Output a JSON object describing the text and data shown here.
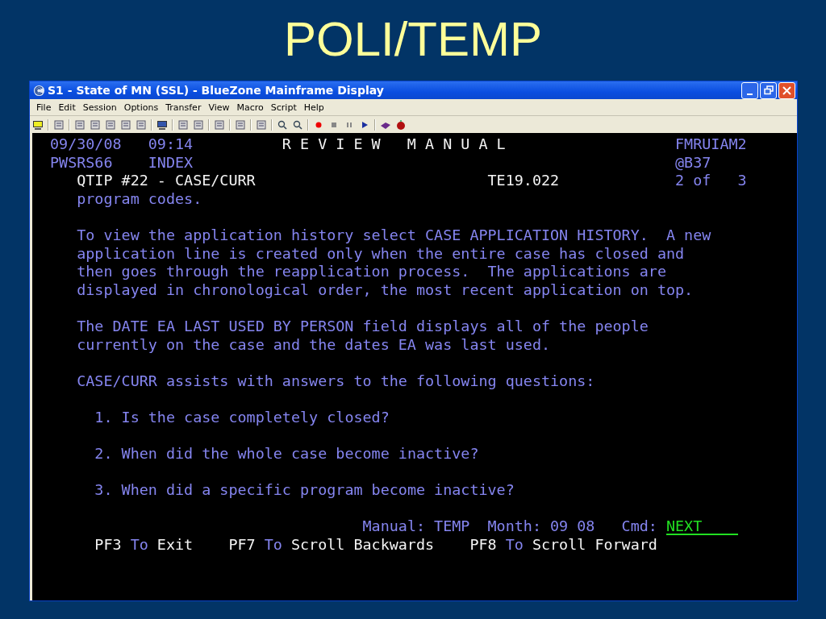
{
  "slide_title": "POLI/TEMP",
  "window": {
    "title": "S1 - State of MN (SSL) - BlueZone Mainframe Display",
    "menu": [
      {
        "label": "File"
      },
      {
        "label": "Edit"
      },
      {
        "label": "Session"
      },
      {
        "label": "Options"
      },
      {
        "label": "Transfer"
      },
      {
        "label": "View"
      },
      {
        "label": "Macro"
      },
      {
        "label": "Script"
      },
      {
        "label": "Help"
      }
    ]
  },
  "terminal": {
    "header": {
      "date": "09/30/08",
      "time": "09:14",
      "screen_title": "R E V I E W   M A N U A L",
      "screen_id": "FMRUIAM2",
      "user": "PWSRS66",
      "mode": "INDEX",
      "location": "@B37",
      "topic": "QTIP #22 - CASE/CURR",
      "reference": "TE19.022",
      "page": "2 of",
      "page_total": "3"
    },
    "body": [
      {
        "kind": "text",
        "lines": [
          "program codes."
        ]
      },
      {
        "kind": "text",
        "lines": [
          "To view the application history select CASE APPLICATION HISTORY.  A new",
          "application line is created only when the entire case has closed and",
          "then goes through the reapplication process.  The applications are",
          "displayed in chronological order, the most recent application on top."
        ]
      },
      {
        "kind": "text",
        "lines": [
          "The DATE EA LAST USED BY PERSON field displays all of the people",
          "currently on the case and the dates EA was last used."
        ]
      },
      {
        "kind": "text",
        "lines": [
          "CASE/CURR assists with answers to the following questions:"
        ]
      },
      {
        "kind": "item",
        "lines": [
          "1. Is the case completely closed?"
        ]
      },
      {
        "kind": "item",
        "lines": [
          "2. When did the whole case become inactive?"
        ]
      },
      {
        "kind": "item",
        "lines": [
          "3. When did a specific program become inactive?"
        ]
      }
    ],
    "footer": {
      "manual_label": "Manual:",
      "manual": "TEMP",
      "month_label": "Month:",
      "month": "09 08",
      "cmd_label": "Cmd:",
      "cmd": "NEXT",
      "keys": [
        {
          "key": "PF3",
          "to": "To",
          "action": "Exit"
        },
        {
          "key": "PF7",
          "to": "To",
          "action": "Scroll Backwards"
        },
        {
          "key": "PF8",
          "to": "To",
          "action": "Scroll Forward"
        }
      ]
    }
  }
}
